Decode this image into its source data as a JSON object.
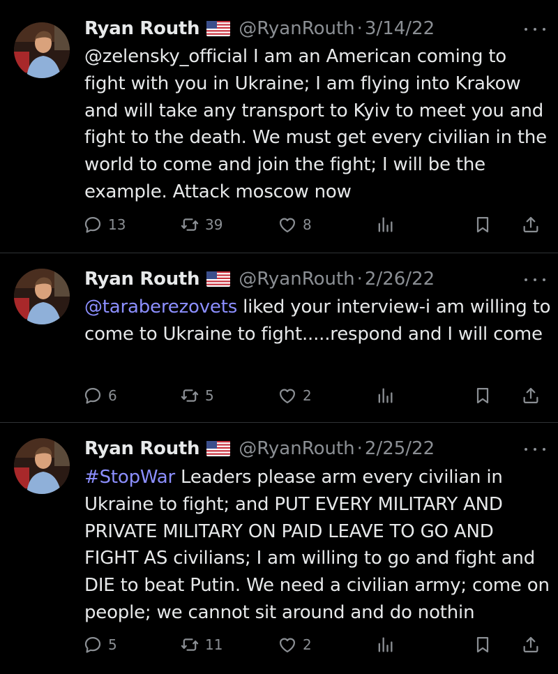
{
  "tweets": [
    {
      "name": "Ryan Routh",
      "handle": "@RyanRouth",
      "sep": "·",
      "date": "3/14/22",
      "lead": "@zelensky_official",
      "text": " I am an American coming to fight with you in Ukraine; I am flying into Krakow and will take any transport to Kyiv to meet you and fight to the death.  We must get every civilian in the world to come and join the fight; I will be the example.  Attack moscow now",
      "replies": "13",
      "reposts": "39",
      "likes": "8"
    },
    {
      "name": "Ryan Routh",
      "handle": "@RyanRouth",
      "sep": "·",
      "date": "2/26/22",
      "lead": "@taraberezovets",
      "text": " liked your interview-i am willing to come to Ukraine to fight.....respond and I will come",
      "replies": "6",
      "reposts": "5",
      "likes": "2"
    },
    {
      "name": "Ryan Routh",
      "handle": "@RyanRouth",
      "sep": "·",
      "date": "2/25/22",
      "lead": "#StopWar",
      "text": " Leaders please arm every civilian in Ukraine to fight; and PUT EVERY MILITARY AND PRIVATE MILITARY ON PAID LEAVE TO GO AND FIGHT AS civilians; I am willing to go and fight and DIE to beat Putin.  We need a civilian army; come on people; we cannot sit around and do nothin",
      "replies": "5",
      "reposts": "11",
      "likes": "2"
    }
  ],
  "icons": {
    "avatar": "profile-photo",
    "flag": "us-flag-emoji",
    "more": "more-dots-icon",
    "reply": "reply-icon",
    "repost": "repost-icon",
    "like": "heart-icon",
    "views": "views-icon",
    "bookmark": "bookmark-icon",
    "share": "share-icon"
  },
  "colors": {
    "background": "#000000",
    "text": "#e7e9ea",
    "secondary": "#8b8f94",
    "mention": "#8c8fff",
    "divider": "#2f3336"
  }
}
